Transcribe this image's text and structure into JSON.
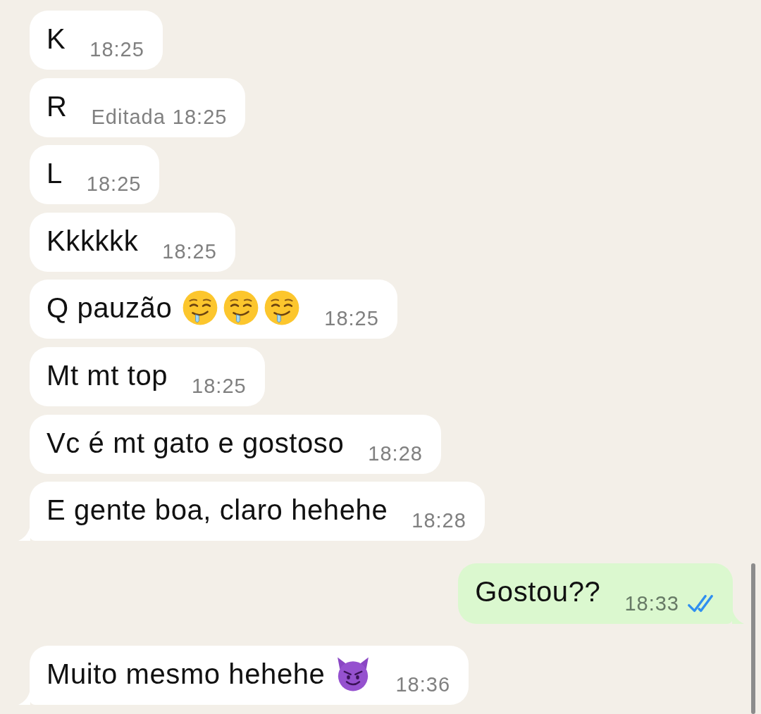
{
  "messages": [
    {
      "kind": "incoming",
      "text": "K",
      "time": "18:25",
      "tail": false
    },
    {
      "kind": "incoming",
      "text": "R",
      "edited_label": "Editada",
      "time": "18:25",
      "tail": false
    },
    {
      "kind": "incoming",
      "text": "L",
      "time": "18:25",
      "tail": false
    },
    {
      "kind": "incoming",
      "text": "Kkkkkk",
      "time": "18:25",
      "tail": false
    },
    {
      "kind": "incoming",
      "text": "Q pauzão",
      "emojis": [
        {
          "kind": "drooling"
        },
        {
          "kind": "drooling"
        },
        {
          "kind": "drooling"
        }
      ],
      "time": "18:25",
      "tail": false
    },
    {
      "kind": "incoming",
      "text": "Mt mt top",
      "time": "18:25",
      "tail": false
    },
    {
      "kind": "incoming",
      "text": "Vc é mt gato e gostoso",
      "time": "18:28",
      "tail": false
    },
    {
      "kind": "incoming",
      "text": "E gente boa, claro hehehe",
      "time": "18:28",
      "tail": true
    },
    {
      "kind": "outgoing",
      "text": "Gostou??",
      "time": "18:33",
      "read": true,
      "tail": true
    },
    {
      "kind": "incoming",
      "text": "Muito mesmo hehehe",
      "emojis": [
        {
          "kind": "devil"
        }
      ],
      "time": "18:36",
      "tail": true
    }
  ]
}
